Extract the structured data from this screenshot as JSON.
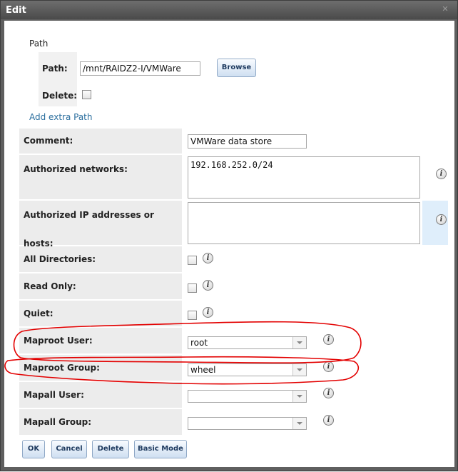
{
  "window": {
    "title": "Edit"
  },
  "path_section": {
    "heading": "Path",
    "path_label": "Path:",
    "path_value": "/mnt/RAIDZ2-I/VMWare",
    "browse_label": "Browse",
    "delete_label": "Delete:",
    "add_extra_path": "Add extra Path"
  },
  "form": {
    "comment": {
      "label": "Comment:",
      "value": "VMWare data store"
    },
    "authorized_networks": {
      "label": "Authorized networks:",
      "value": "192.168.252.0/24"
    },
    "authorized_hosts": {
      "label": "Authorized IP addresses or hosts:",
      "value": ""
    },
    "all_directories": {
      "label": "All Directories:"
    },
    "read_only": {
      "label": "Read Only:"
    },
    "quiet": {
      "label": "Quiet:"
    },
    "maproot_user": {
      "label": "Maproot User:",
      "value": "root"
    },
    "maproot_group": {
      "label": "Maproot Group:",
      "value": "wheel"
    },
    "mapall_user": {
      "label": "Mapall User:",
      "value": ""
    },
    "mapall_group": {
      "label": "Mapall Group:",
      "value": ""
    }
  },
  "buttons": {
    "ok": "OK",
    "cancel": "Cancel",
    "delete": "Delete",
    "basic_mode": "Basic Mode"
  },
  "annotation_color": "#e30000",
  "info_icon_glyph": "i"
}
